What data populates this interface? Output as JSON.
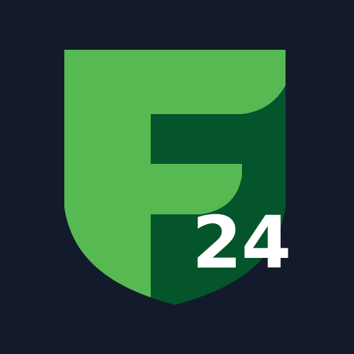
{
  "logo": {
    "badge_number": "24",
    "colors": {
      "background": "#131a2b",
      "shield_light": "#56b952",
      "shield_dark": "#04552b",
      "text": "#ffffff"
    },
    "icon": "shield-f-logo"
  }
}
